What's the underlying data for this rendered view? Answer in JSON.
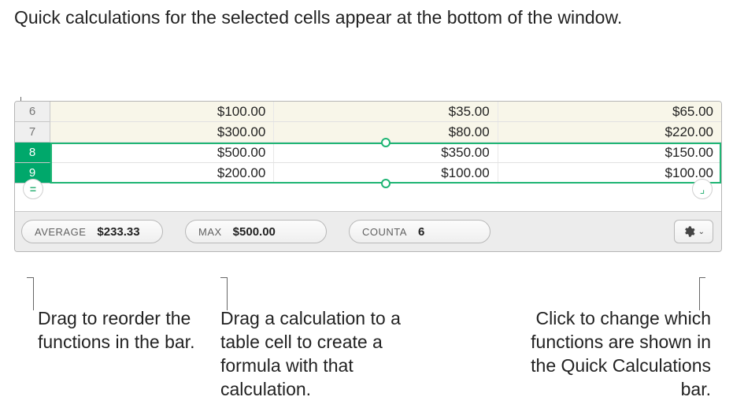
{
  "callouts": {
    "top": "Quick calculations for the selected cells appear at the bottom of the window.",
    "reorder": "Drag to reorder the functions in the bar.",
    "drag_formula": "Drag a calculation to a table cell to create a formula with that calculation.",
    "gear": "Click to change which functions are shown in the Quick Calculations bar."
  },
  "rows": [
    {
      "num": "6",
      "selected": false,
      "cells": [
        "$100.00",
        "$35.00",
        "$65.00"
      ]
    },
    {
      "num": "7",
      "selected": false,
      "cells": [
        "$300.00",
        "$80.00",
        "$220.00"
      ]
    },
    {
      "num": "8",
      "selected": true,
      "cells": [
        "$500.00",
        "$350.00",
        "$150.00"
      ]
    },
    {
      "num": "9",
      "selected": true,
      "cells": [
        "$200.00",
        "$100.00",
        "$100.00"
      ]
    }
  ],
  "quickcalc": [
    {
      "fn": "AVERAGE",
      "val": "$233.33"
    },
    {
      "fn": "MAX",
      "val": "$500.00"
    },
    {
      "fn": "COUNTA",
      "val": "6"
    }
  ],
  "icons": {
    "add_row": "=",
    "add_col": "⌟"
  }
}
